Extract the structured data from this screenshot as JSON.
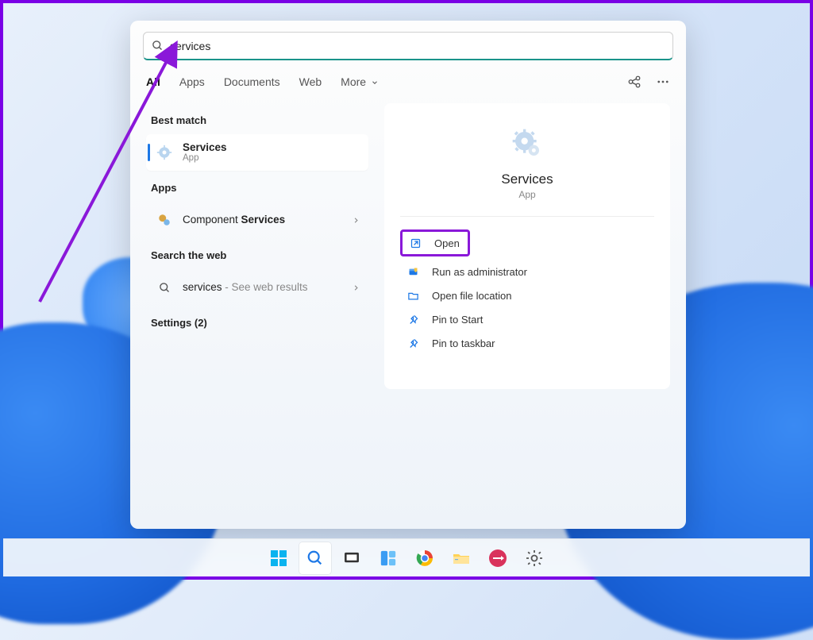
{
  "search": {
    "value": "services"
  },
  "tabs": {
    "all": "All",
    "apps": "Apps",
    "documents": "Documents",
    "web": "Web",
    "more": "More"
  },
  "sections": {
    "best_match": "Best match",
    "apps": "Apps",
    "search_web": "Search the web",
    "settings": "Settings (2)"
  },
  "results": {
    "best": {
      "title": "Services",
      "sub": "App"
    },
    "app1": {
      "prefix": "Component ",
      "bold": "Services"
    },
    "web1": {
      "prefix": "services",
      "suffix": " - See web results"
    }
  },
  "detail": {
    "title": "Services",
    "sub": "App",
    "actions": {
      "open": "Open",
      "run_admin": "Run as administrator",
      "open_loc": "Open file location",
      "pin_start": "Pin to Start",
      "pin_taskbar": "Pin to taskbar"
    }
  }
}
